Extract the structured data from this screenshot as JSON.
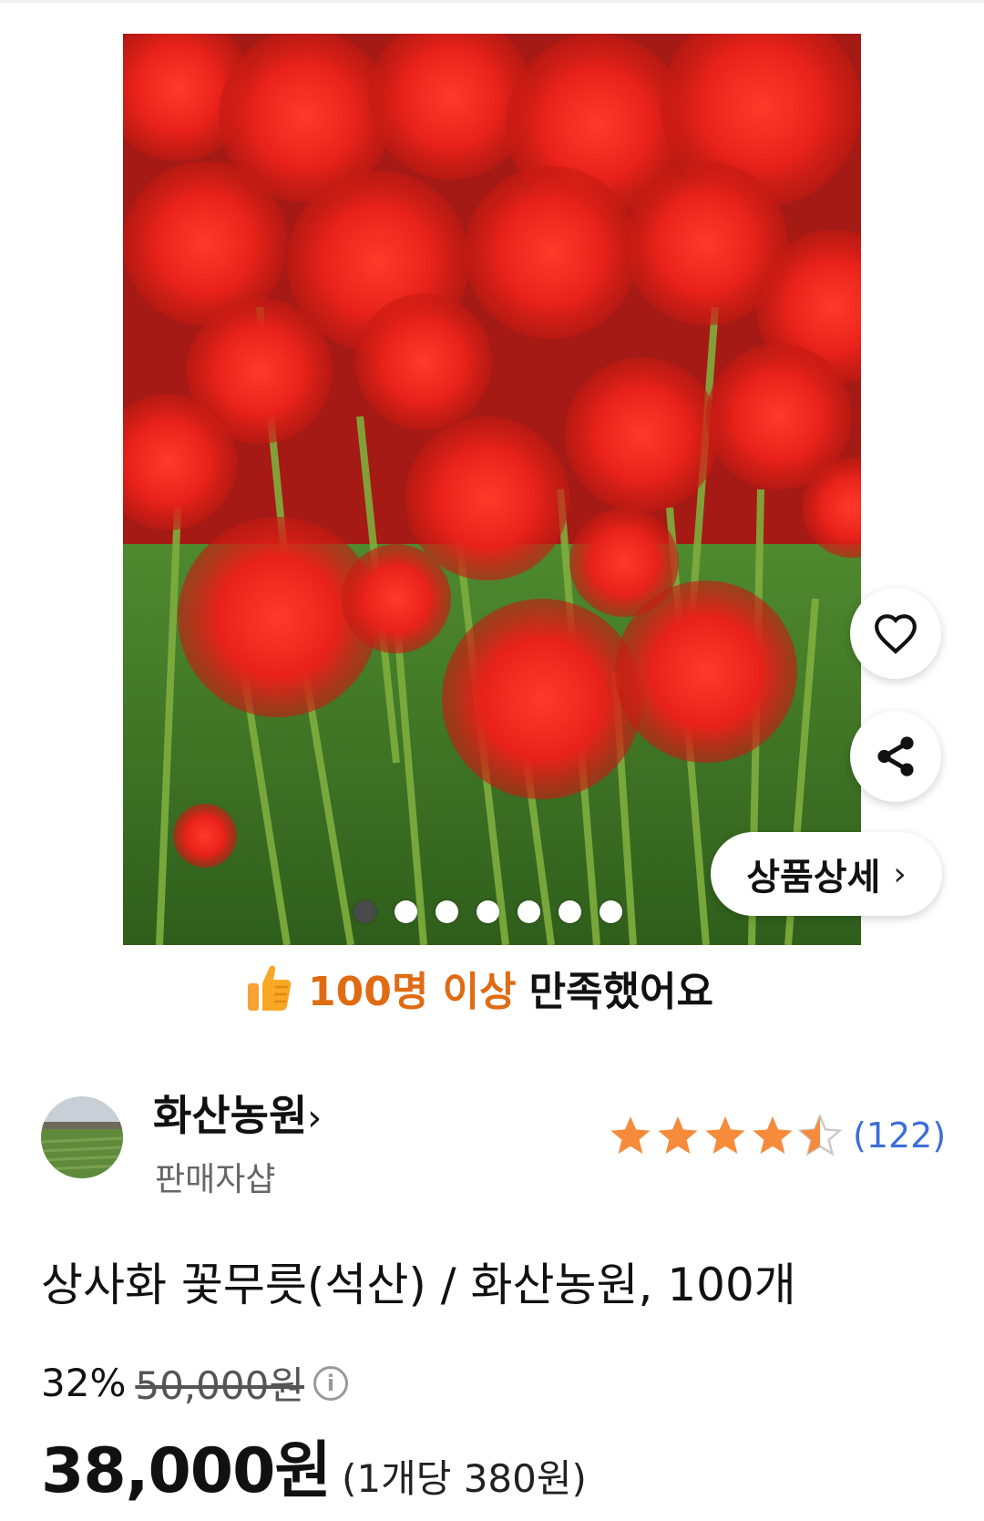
{
  "gallery": {
    "slide_count": 7,
    "active_index": 0,
    "detail_button_label": "상품상세",
    "detail_chevron": "›",
    "like_icon": "heart-icon",
    "share_icon": "share-icon"
  },
  "satisfaction": {
    "icon": "thumbs-up-icon",
    "count_text": "100명 이상",
    "rest_text": "만족했어요"
  },
  "seller": {
    "name": "화산농원",
    "name_chevron": "›",
    "type": "판매자샵"
  },
  "rating": {
    "stars": 4.5,
    "max": 5,
    "review_count": "(122)"
  },
  "product": {
    "title": "상사화 꽃무릇(석산) / 화산농원, 100개"
  },
  "price": {
    "discount": "32%",
    "original": "50,000원",
    "sale": "38,000원",
    "unit": "(1개당 380원)"
  },
  "colors": {
    "accent_orange": "#e06b12",
    "star": "#f58b3b",
    "link_blue": "#3c6ed6"
  }
}
